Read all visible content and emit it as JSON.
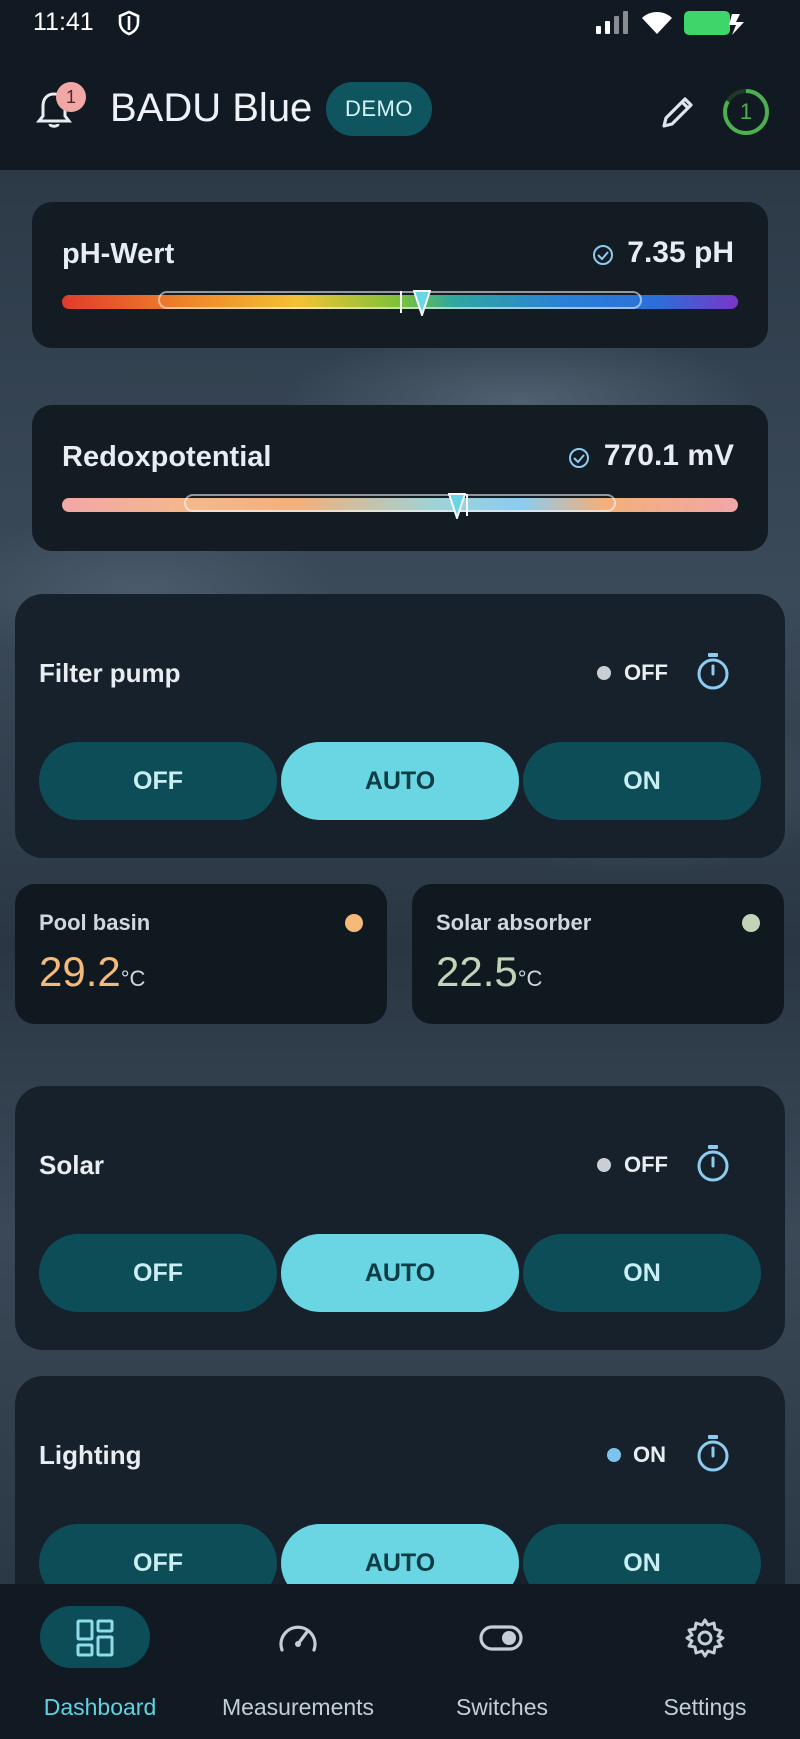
{
  "status_bar": {
    "time": "11:41"
  },
  "header": {
    "notification_count": "1",
    "title": "BADU Blue",
    "badge": "DEMO",
    "progress_value": "1"
  },
  "sensors": [
    {
      "name": "pH-Wert",
      "value": "7.35 pH"
    },
    {
      "name": "Redoxpotential",
      "value": "770.1 mV"
    }
  ],
  "switches": {
    "filter_pump": {
      "name": "Filter pump",
      "status": "OFF",
      "options": [
        "OFF",
        "AUTO",
        "ON"
      ],
      "selected": "AUTO"
    },
    "solar": {
      "name": "Solar",
      "status": "OFF",
      "options": [
        "OFF",
        "AUTO",
        "ON"
      ],
      "selected": "AUTO"
    },
    "lighting": {
      "name": "Lighting",
      "status": "ON",
      "options": [
        "OFF",
        "AUTO",
        "ON"
      ],
      "selected": "AUTO"
    }
  },
  "temperatures": [
    {
      "name": "Pool basin",
      "value": "29.2",
      "unit": "°C",
      "color": "#f5b97a"
    },
    {
      "name": "Solar absorber",
      "value": "22.5",
      "unit": "°C",
      "color": "#c2d4b8"
    }
  ],
  "nav": [
    {
      "label": "Dashboard",
      "icon": "dashboard-icon",
      "active": true
    },
    {
      "label": "Measurements",
      "icon": "gauge-icon",
      "active": false
    },
    {
      "label": "Switches",
      "icon": "toggle-icon",
      "active": false
    },
    {
      "label": "Settings",
      "icon": "gear-icon",
      "active": false
    }
  ],
  "colors": {
    "accent": "#6ad6e4",
    "segment": "#0c4d57",
    "status_off": "#c9cfd4",
    "status_on": "#7cc4f0"
  }
}
